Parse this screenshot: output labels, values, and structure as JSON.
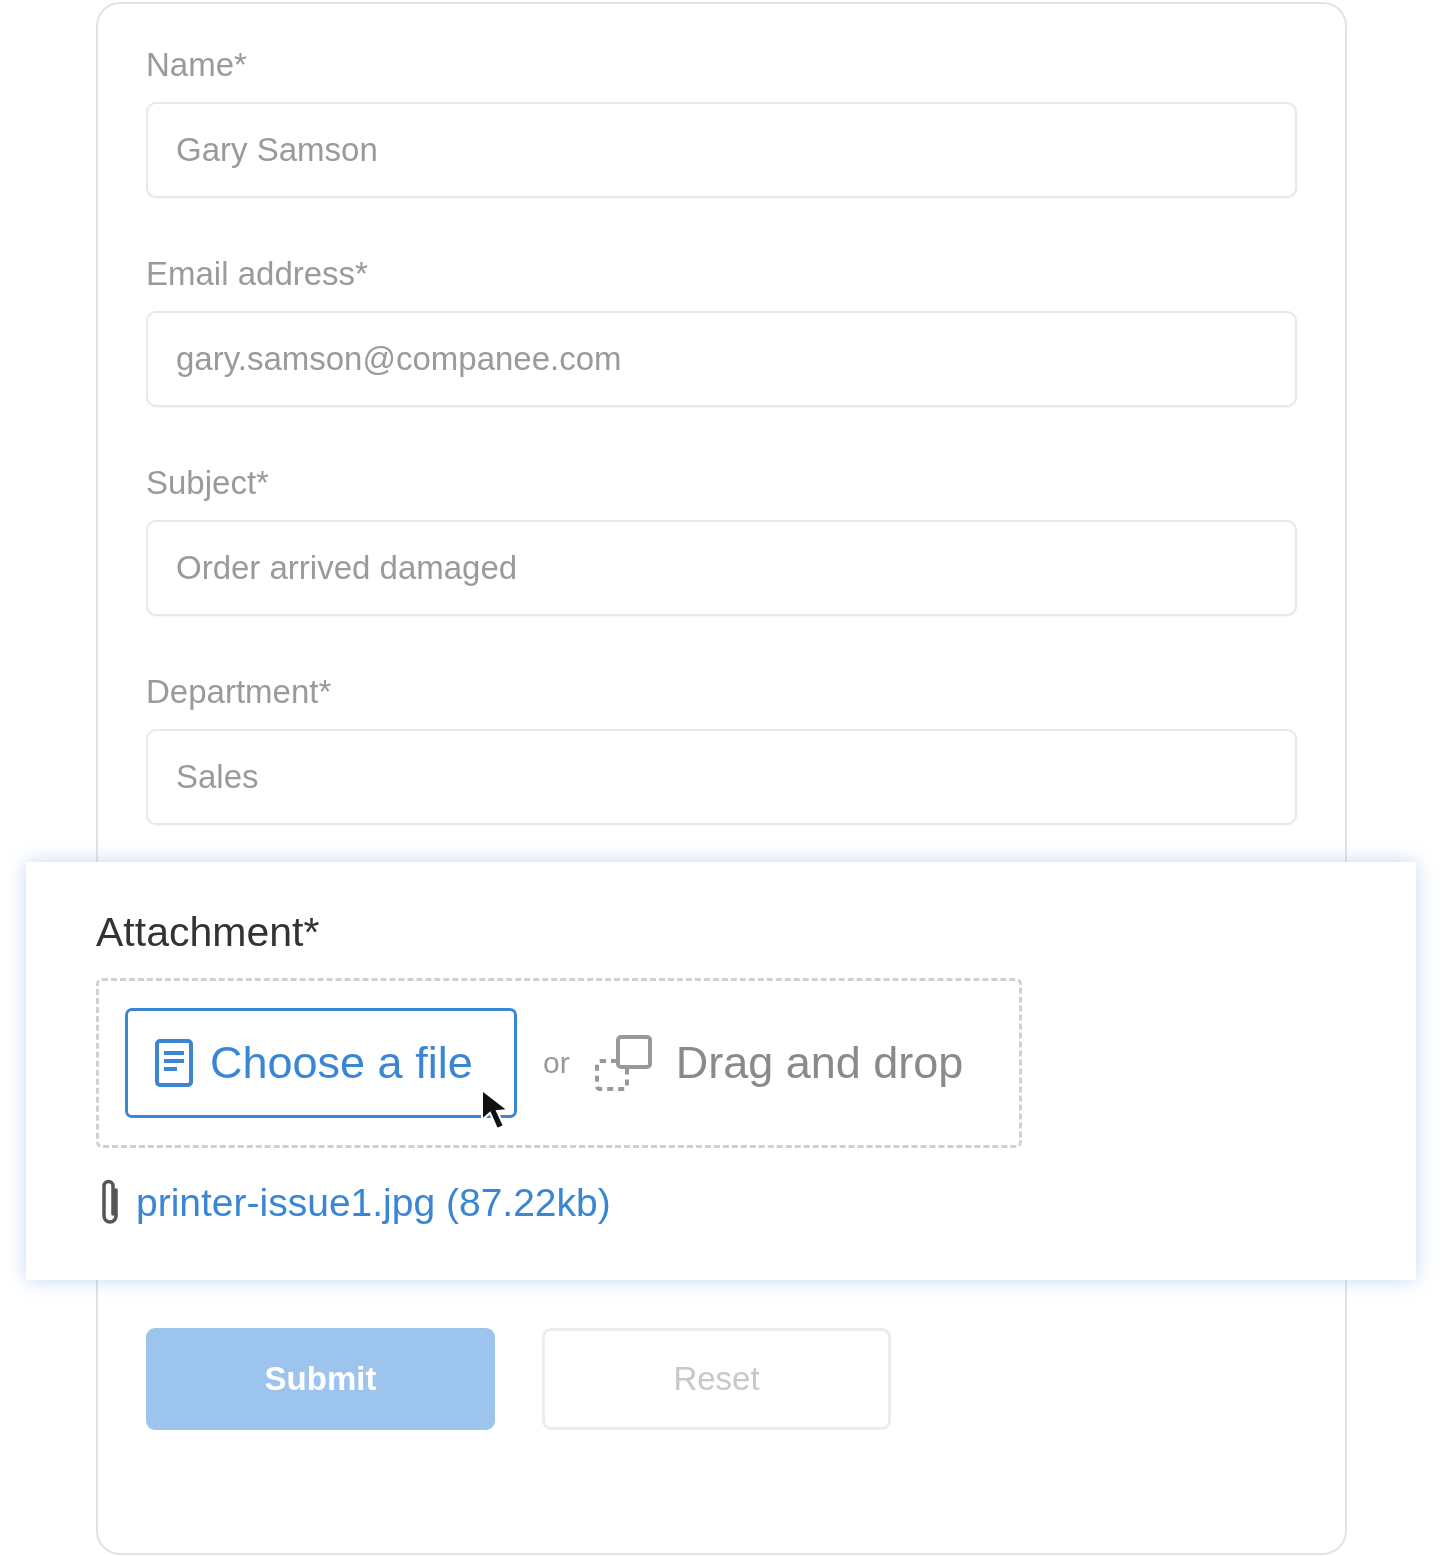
{
  "fields": [
    {
      "label": "Name*",
      "value": "Gary Samson"
    },
    {
      "label": "Email address*",
      "value": "gary.samson@companee.com"
    },
    {
      "label": "Subject*",
      "value": "Order arrived damaged"
    },
    {
      "label": "Department*",
      "value": "Sales"
    }
  ],
  "attachment": {
    "label": "Attachment*",
    "choose_button": "Choose a file",
    "separator": "or",
    "drop_label": "Drag and drop",
    "file": "printer-issue1.jpg (87.22kb)"
  },
  "buttons": [
    {
      "label": "Submit",
      "kind": "primary",
      "disabled": true
    },
    {
      "label": "Reset",
      "kind": "secondary",
      "disabled": true
    }
  ]
}
